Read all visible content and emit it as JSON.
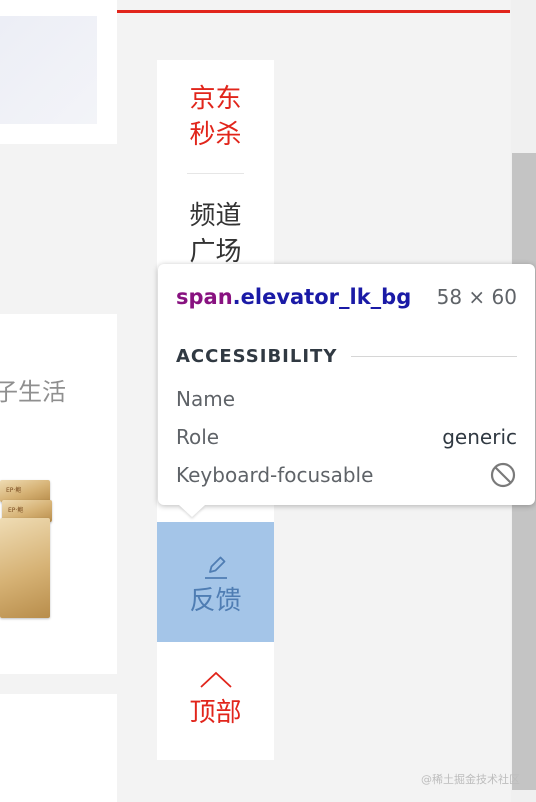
{
  "elevator": {
    "seckill_line1": "京东",
    "seckill_line2": "秒杀",
    "channel_line1": "频道",
    "channel_line2": "广场",
    "feedback_label": "反馈",
    "feedback_icon": "pencil-icon",
    "top_label": "顶部",
    "top_icon": "caret-up-icon"
  },
  "left_page": {
    "promo_text": "子生活",
    "book_label": "EP·鲍"
  },
  "tooltip": {
    "selector_tag": "span",
    "selector_class": ".elevator_lk_bg",
    "size": "58 × 60",
    "section_title": "ACCESSIBILITY",
    "rows": [
      {
        "label": "Name",
        "value": ""
      },
      {
        "label": "Role",
        "value": "generic"
      },
      {
        "label": "Keyboard-focusable",
        "value_icon": "not-allowed-icon"
      }
    ]
  },
  "watermark": "@稀土掘金技术社区",
  "colors": {
    "jd_red": "#e1251b",
    "feedback_highlight": "#a4c5e8",
    "devtools_tag": "#881280",
    "devtools_class": "#1a1aa6"
  }
}
